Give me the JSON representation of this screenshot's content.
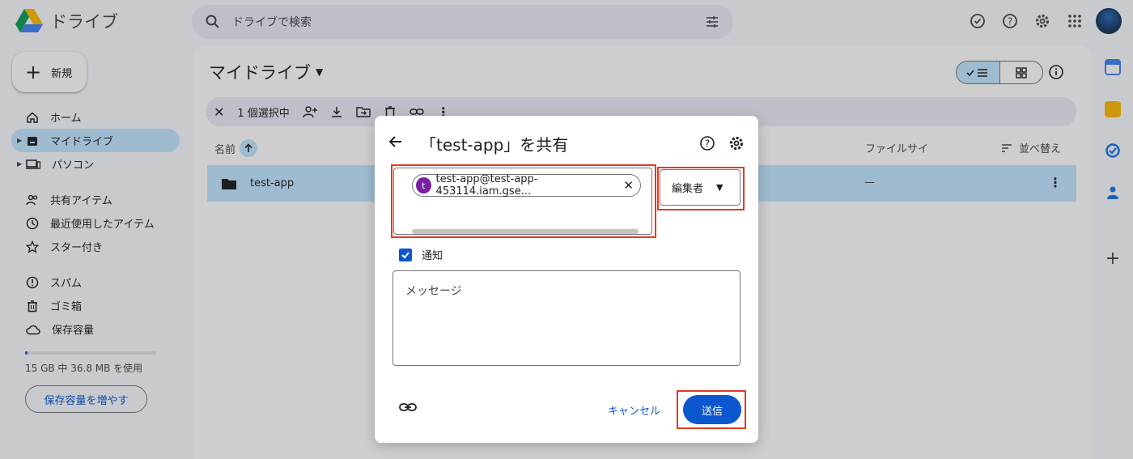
{
  "app": {
    "title": "ドライブ"
  },
  "search": {
    "placeholder": "ドライブで検索"
  },
  "sidebar": {
    "new_label": "新規",
    "items": [
      {
        "label": "ホーム"
      },
      {
        "label": "マイドライブ"
      },
      {
        "label": "パソコン"
      },
      {
        "label": "共有アイテム"
      },
      {
        "label": "最近使用したアイテム"
      },
      {
        "label": "スター付き"
      },
      {
        "label": "スパム"
      },
      {
        "label": "ゴミ箱"
      },
      {
        "label": "保存容量"
      }
    ],
    "storage_text": "15 GB 中 36.8 MB を使用",
    "storage_fraction": 0.0024,
    "storage_button": "保存容量を増やす"
  },
  "main": {
    "title": "マイドライブ",
    "selection_text": "1 個選択中",
    "columns": {
      "name": "名前",
      "size": "ファイルサイ",
      "sort": "並べ替え"
    },
    "files": [
      {
        "name": "test-app",
        "size": "—"
      }
    ]
  },
  "dialog": {
    "title": "「test-app」を共有",
    "recipient_initial": "t",
    "recipient_email": "test-app@test-app-453114.iam.gse...",
    "role": "編集者",
    "notify_label": "通知",
    "message_placeholder": "メッセージ",
    "cancel_label": "キャンセル",
    "send_label": "送信"
  },
  "colors": {
    "accent": "#0b57d0",
    "selected_bg": "#c2e7ff",
    "highlight": "#e53a1f"
  }
}
